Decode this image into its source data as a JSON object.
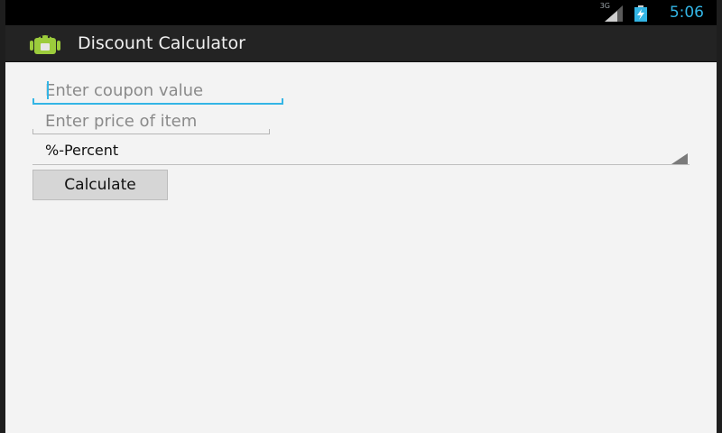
{
  "status_bar": {
    "network_type": "3G",
    "time": "5:06",
    "icons": [
      "signal-icon",
      "battery-charging-icon"
    ]
  },
  "action_bar": {
    "title": "Discount Calculator",
    "icon": "android-app-icon"
  },
  "form": {
    "coupon_field": {
      "placeholder": "Enter coupon value",
      "value": ""
    },
    "price_field": {
      "placeholder": "Enter price of item",
      "value": ""
    },
    "discount_type": {
      "selected": "%-Percent"
    },
    "calculate_label": "Calculate"
  },
  "colors": {
    "accent": "#33b5e5",
    "background": "#f3f3f3",
    "action_bar": "#232323",
    "status_bar": "#000000"
  }
}
